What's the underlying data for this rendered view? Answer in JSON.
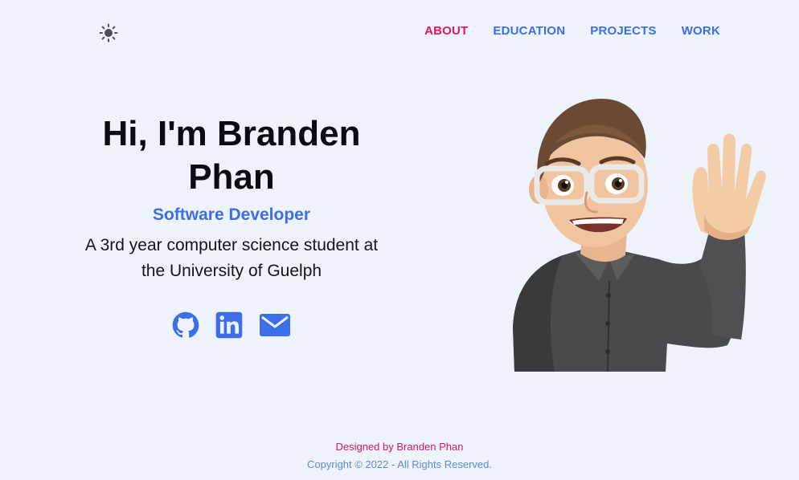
{
  "header": {
    "theme_icon": "sun-icon",
    "nav": [
      {
        "label": "ABOUT",
        "active": true
      },
      {
        "label": "EDUCATION",
        "active": false
      },
      {
        "label": "PROJECTS",
        "active": false
      },
      {
        "label": "WORK",
        "active": false
      }
    ]
  },
  "hero": {
    "title_line1": "Hi, I'm Branden",
    "title_line2": "Phan",
    "role": "Software Developer",
    "desc_line1": "A 3rd year computer science student at",
    "desc_line2": "the University of Guelph",
    "socials": [
      "github-icon",
      "linkedin-icon",
      "email-icon"
    ],
    "avatar": "waving-memoji-avatar"
  },
  "footer": {
    "credit": "Designed by Branden Phan",
    "copyright": "Copyright © 2022 - All Rights Reserved."
  },
  "colors": {
    "background": "#eef2fb",
    "accent_blue": "#3b6ee8",
    "accent_pink": "#e0185e"
  }
}
